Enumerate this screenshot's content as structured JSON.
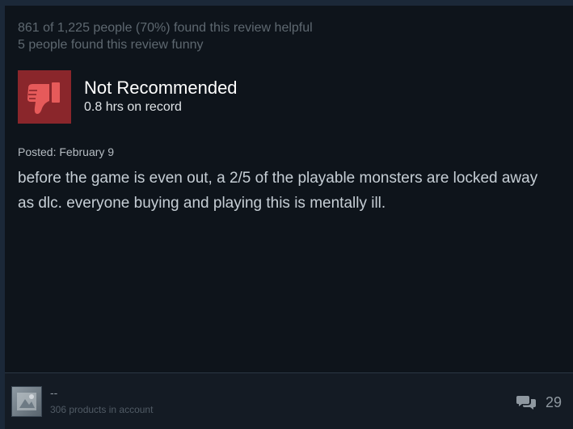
{
  "review": {
    "helpful_text": "861 of 1,225 people (70%) found this review helpful",
    "funny_text": "5 people found this review funny",
    "verdict": "Not Recommended",
    "hours": "0.8 hrs on record",
    "posted": "Posted: February 9",
    "body": "before the game is even out, a 2/5 of the playable monsters are locked away as dlc. everyone buying and playing this is mentally ill."
  },
  "author": {
    "name": "--",
    "products": "306 products in account"
  },
  "comments": {
    "count": "29",
    "icon": "comments-icon"
  },
  "colors": {
    "thumb_bg": "#8a262b",
    "thumb_fg": "#e65a5a",
    "card_bg": "#0e141b",
    "page_bg": "#1b2838"
  }
}
